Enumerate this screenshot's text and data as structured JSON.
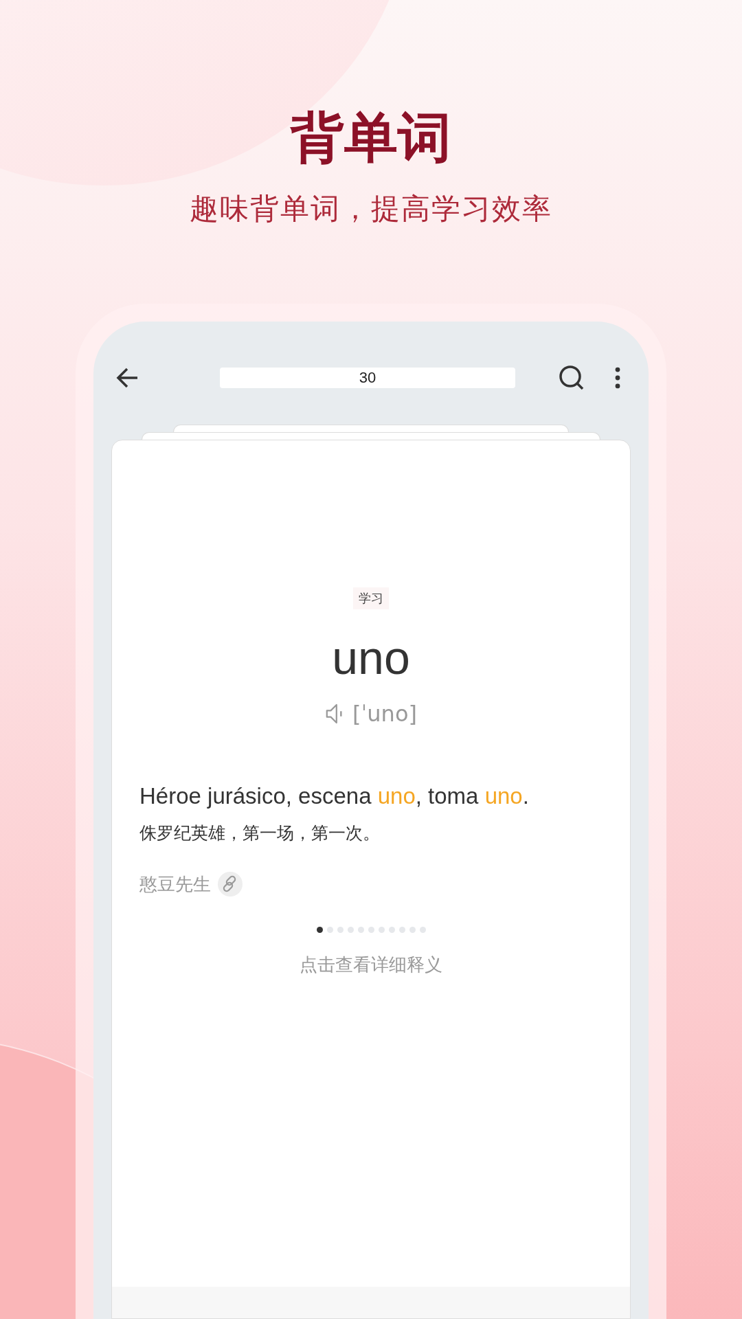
{
  "headline": {
    "title": "背单词",
    "subtitle": "趣味背单词，提高学习效率"
  },
  "toolbar": {
    "field_value": "30"
  },
  "card": {
    "tag": "学习",
    "word": "uno",
    "phonetic": "[ˈuno]",
    "example": [
      {
        "text": "Héroe jurásico, escena ",
        "highlight": false
      },
      {
        "text": "uno",
        "highlight": true
      },
      {
        "text": ", toma ",
        "highlight": false
      },
      {
        "text": "uno",
        "highlight": true
      },
      {
        "text": ".",
        "highlight": false
      }
    ],
    "translation": "侏罗纪英雄，第一场，第一次。",
    "author": "憨豆先生",
    "pager": [
      {
        "selected": true
      },
      {
        "selected": false
      },
      {
        "selected": false
      },
      {
        "selected": false
      },
      {
        "selected": false
      },
      {
        "selected": false
      },
      {
        "selected": false
      },
      {
        "selected": false
      },
      {
        "selected": false
      },
      {
        "selected": false
      },
      {
        "selected": false
      }
    ],
    "hint": "点击查看详细释义"
  }
}
